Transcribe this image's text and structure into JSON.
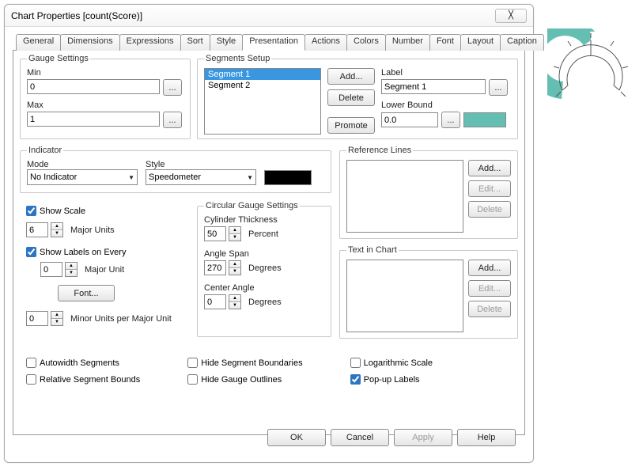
{
  "dialog": {
    "title": "Chart Properties [count(Score)]",
    "close_glyph": "╳"
  },
  "tabs": [
    {
      "label": "General"
    },
    {
      "label": "Dimensions"
    },
    {
      "label": "Expressions"
    },
    {
      "label": "Sort"
    },
    {
      "label": "Style"
    },
    {
      "label": "Presentation"
    },
    {
      "label": "Actions"
    },
    {
      "label": "Colors"
    },
    {
      "label": "Number"
    },
    {
      "label": "Font"
    },
    {
      "label": "Layout"
    },
    {
      "label": "Caption"
    }
  ],
  "gauge": {
    "legend": "Gauge Settings",
    "min_label": "Min",
    "min_value": "0",
    "max_label": "Max",
    "max_value": "1",
    "ellipsis": "..."
  },
  "segments": {
    "legend": "Segments Setup",
    "items": [
      "Segment 1",
      "Segment 2"
    ],
    "add": "Add...",
    "delete": "Delete",
    "promote": "Promote",
    "label_lbl": "Label",
    "label_value": "Segment 1",
    "lower_bound_lbl": "Lower Bound",
    "lower_bound_value": "0.0",
    "swatch_color": "#64beb1",
    "ellipsis": "..."
  },
  "indicator": {
    "legend": "Indicator",
    "mode_lbl": "Mode",
    "mode_value": "No Indicator",
    "style_lbl": "Style",
    "style_value": "Speedometer",
    "indicator_color": "#000000"
  },
  "scale": {
    "show_scale": "Show Scale",
    "major_units_value": "6",
    "major_units_lbl": "Major Units",
    "show_labels": "Show Labels on Every",
    "labels_value": "0",
    "labels_unit": "Major Unit",
    "font_btn": "Font...",
    "minor_value": "0",
    "minor_lbl": "Minor Units per Major Unit"
  },
  "circular": {
    "legend": "Circular Gauge Settings",
    "thickness_lbl": "Cylinder Thickness",
    "thickness_value": "50",
    "thickness_unit": "Percent",
    "angle_span_lbl": "Angle Span",
    "angle_span_value": "270",
    "angle_span_unit": "Degrees",
    "center_angle_lbl": "Center Angle",
    "center_angle_value": "0",
    "center_angle_unit": "Degrees"
  },
  "ref": {
    "legend": "Reference Lines",
    "add": "Add...",
    "edit": "Edit...",
    "delete": "Delete"
  },
  "textin": {
    "legend": "Text in Chart",
    "add": "Add...",
    "edit": "Edit...",
    "delete": "Delete"
  },
  "checks": {
    "autowidth": "Autowidth Segments",
    "relative": "Relative Segment Bounds",
    "hide_boundaries": "Hide Segment Boundaries",
    "hide_outlines": "Hide Gauge Outlines",
    "log_scale": "Logarithmic Scale",
    "popup_labels": "Pop-up Labels"
  },
  "buttons": {
    "ok": "OK",
    "cancel": "Cancel",
    "apply": "Apply",
    "help": "Help"
  },
  "chart_data": {
    "type": "gauge",
    "thickness_percent": 50,
    "angle_span_deg": 270,
    "center_angle_deg": 0,
    "segments": [
      {
        "name": "Segment 1",
        "lower_bound": 0.0,
        "color": "#64beb1"
      },
      {
        "name": "Segment 2",
        "color": "#ffffff"
      }
    ],
    "min": 0,
    "max": 1,
    "value": null
  }
}
